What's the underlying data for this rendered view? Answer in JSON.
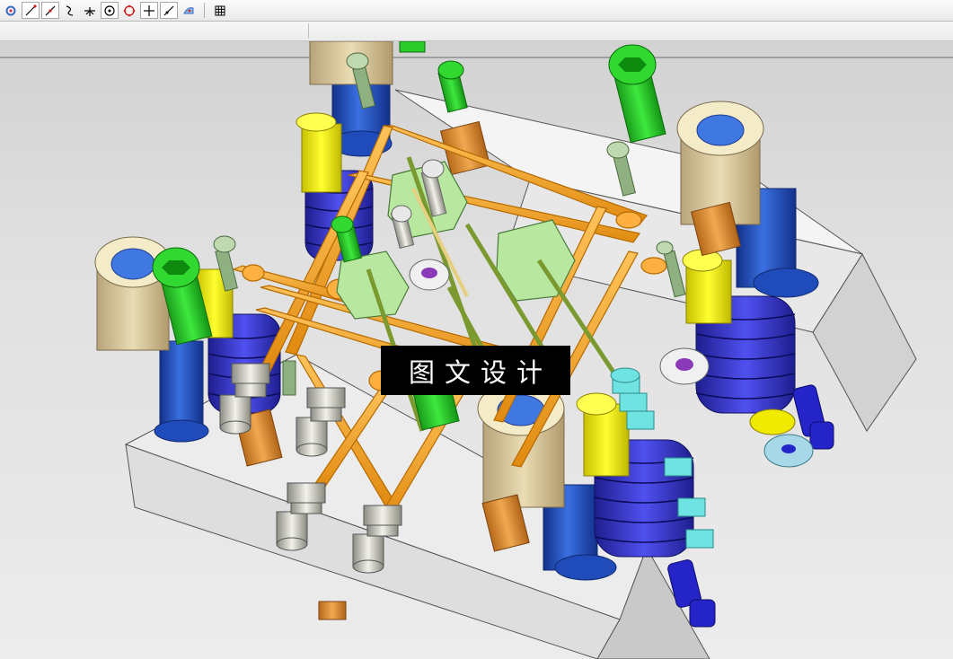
{
  "window": {
    "toolbar": {
      "buttons": [
        {
          "name": "snap-settings-icon"
        },
        {
          "name": "line-icon"
        },
        {
          "name": "line-angle-icon"
        },
        {
          "name": "spline-icon"
        },
        {
          "name": "intersection-point-icon"
        },
        {
          "name": "circle-center-icon"
        },
        {
          "name": "circle-quadrant-icon"
        },
        {
          "name": "crosshair-point-icon"
        },
        {
          "name": "point-on-curve-icon"
        },
        {
          "name": "point-on-face-icon"
        },
        {
          "name": "grid-icon"
        }
      ]
    },
    "viewport": {
      "watermark": "图文设计",
      "colors": {
        "plate": "#e6e6e6",
        "frame": "#f5a623",
        "screw": "#22cc22",
        "spring": "#3a3ad2",
        "bushing": "#d9c89a",
        "pillar": "#2756c9",
        "pin": "#f0ea00",
        "plug": "#e89a3c",
        "cooling_fitting": "#cfcfc5",
        "block": "#b8e8a0",
        "cyan_part": "#6fe2e2"
      }
    }
  }
}
